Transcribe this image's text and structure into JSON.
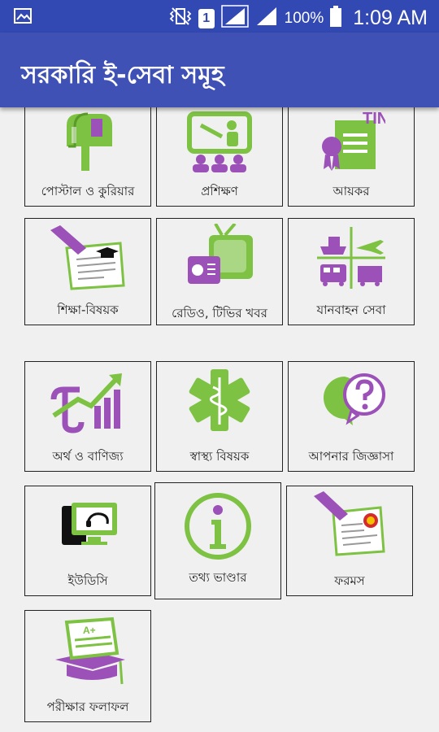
{
  "status_bar": {
    "battery_text": "100%",
    "time": "1:09 AM",
    "sim_label": "1",
    "icons": [
      "screenshot-icon",
      "vibrate-icon",
      "sim-icon",
      "signal-icon",
      "signal-icon",
      "battery-icon"
    ]
  },
  "app_bar": {
    "title": "সরকারি ই-সেবা সমূহ"
  },
  "colors": {
    "statusbar": "#3249b3",
    "appbar": "#3f51b5",
    "green": "#7dc242",
    "purple": "#9b51b7"
  },
  "tiles": [
    {
      "label": "পোস্টাল ও কুরিয়ার",
      "icon": "mailbox-icon"
    },
    {
      "label": "প্রশিক্ষণ",
      "icon": "training-icon"
    },
    {
      "label": "আয়কর",
      "icon": "tax-certificate-icon"
    },
    {
      "label": "শিক্ষা-বিষয়ক",
      "icon": "education-icon"
    },
    {
      "label": "রেডিও, টিভির খবর",
      "icon": "radio-tv-icon"
    },
    {
      "label": "যানবাহন সেবা",
      "icon": "transport-icon"
    },
    {
      "label": "অর্থ ও বাণিজ্য",
      "icon": "finance-icon"
    },
    {
      "label": "স্বাস্থ্য বিষয়ক",
      "icon": "health-icon"
    },
    {
      "label": "আপনার জিজ্ঞাসা",
      "icon": "question-icon"
    },
    {
      "label": "ইউডিসি",
      "icon": "udc-icon"
    },
    {
      "label": "তথ্য ভাণ্ডার",
      "icon": "info-icon"
    },
    {
      "label": "ফরমস",
      "icon": "forms-icon"
    },
    {
      "label": "পরীক্ষার ফলাফল",
      "icon": "exam-result-icon"
    }
  ]
}
